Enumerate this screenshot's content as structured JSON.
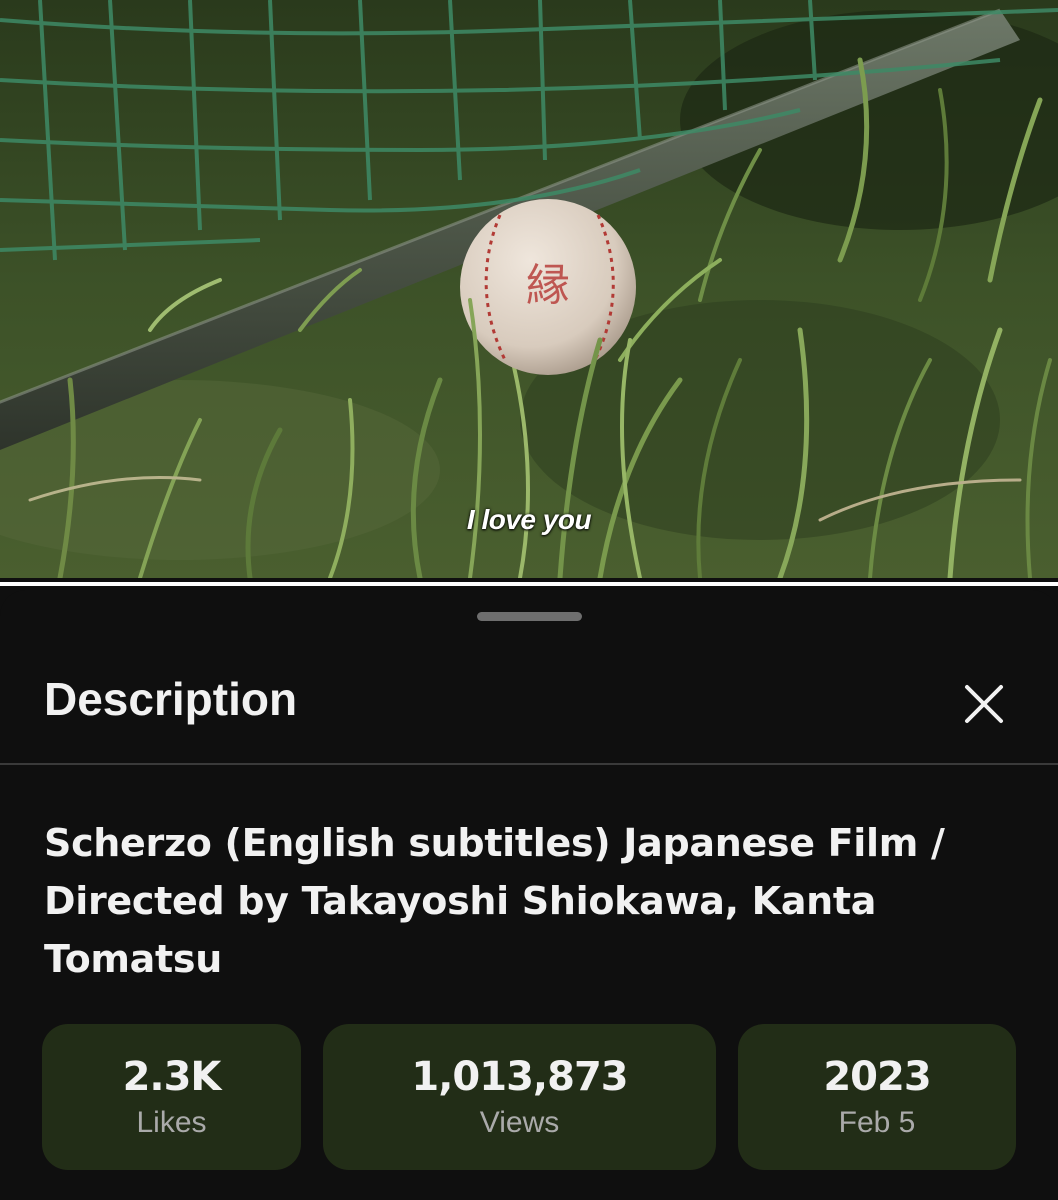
{
  "video": {
    "subtitle": "I love you"
  },
  "description_sheet": {
    "title": "Description",
    "close_icon": "close-icon",
    "video_title": "Scherzo (English subtitles) Japanese Film / Directed by Takayoshi Shiokawa, Kanta Tomatsu",
    "stats": [
      {
        "value": "2.3K",
        "label": "Likes"
      },
      {
        "value": "1,013,873",
        "label": "Views"
      },
      {
        "value": "2023",
        "label": "Feb 5"
      }
    ]
  },
  "colors": {
    "sheet_background": "#0f0f0f",
    "stat_card_background": "#222d17",
    "primary_text": "#f1f1f1",
    "secondary_text": "#aaaaaa"
  }
}
